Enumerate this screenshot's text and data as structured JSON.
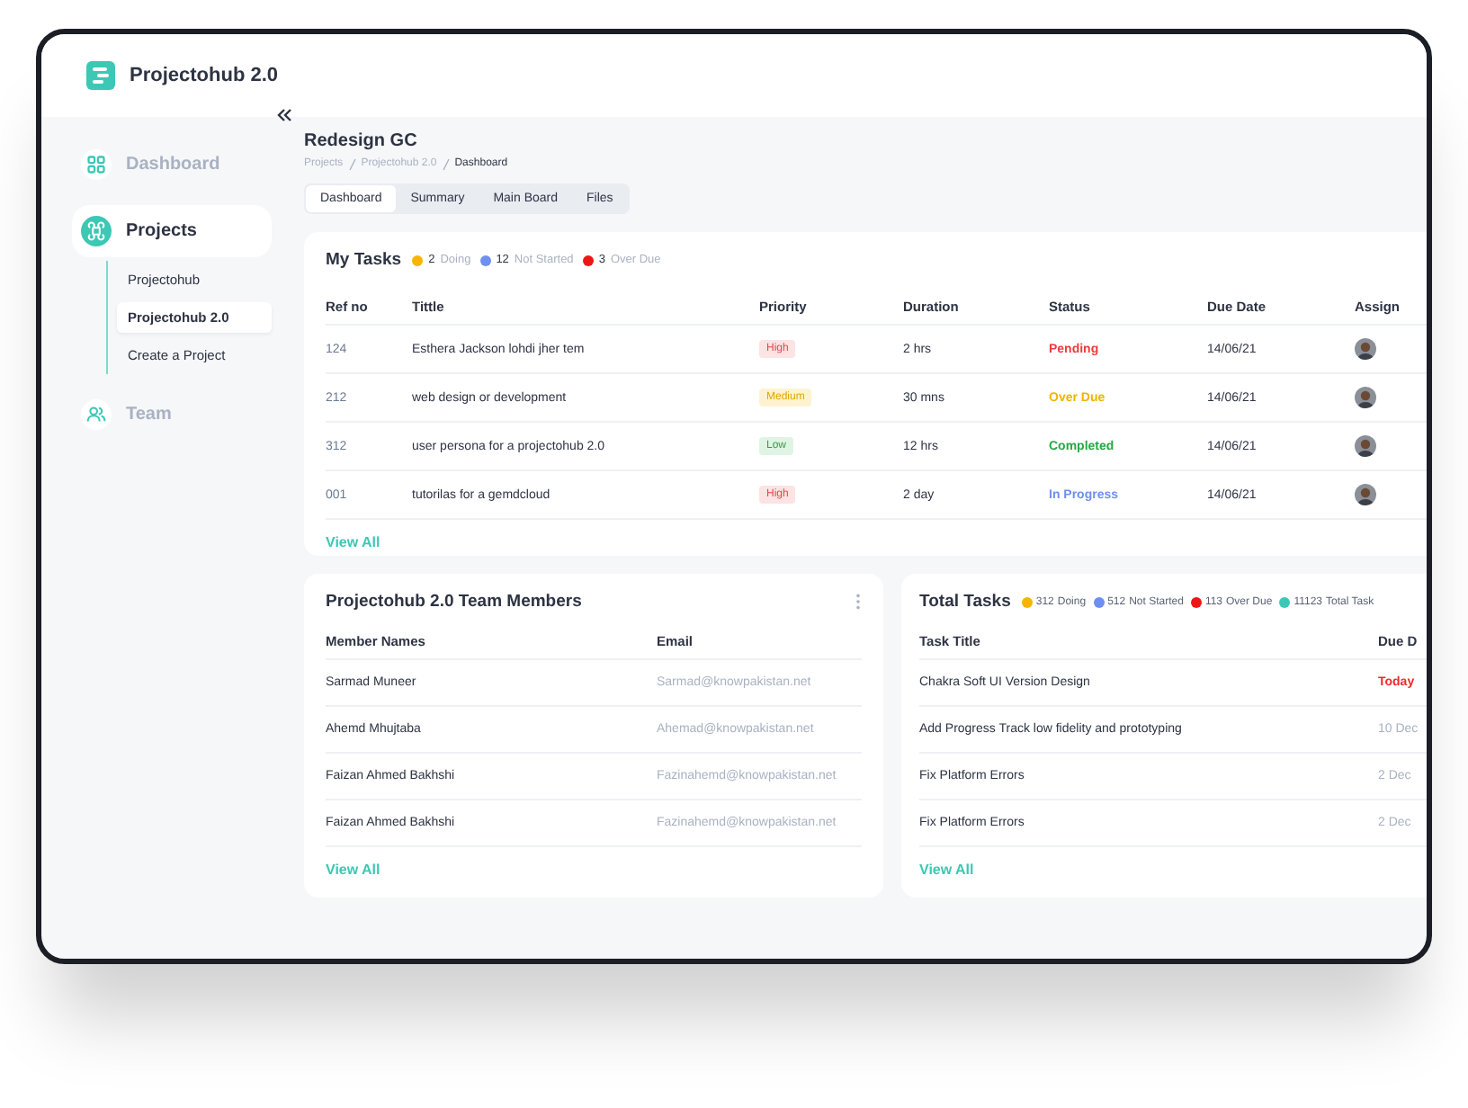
{
  "app": {
    "name": "Projectohub 2.0"
  },
  "sidebar": {
    "items": [
      {
        "label": "Dashboard",
        "kind": "grid",
        "selected": false
      },
      {
        "label": "Projects",
        "kind": "command",
        "selected": true,
        "children": [
          {
            "label": "Projectohub",
            "selected": false
          },
          {
            "label": "Projectohub 2.0",
            "selected": true
          },
          {
            "label": "Create a Project",
            "selected": false
          }
        ]
      },
      {
        "label": "Team",
        "kind": "people",
        "selected": false
      }
    ]
  },
  "page": {
    "title": "Redesign GC",
    "breadcrumb": [
      "Projects",
      "Projectohub 2.0",
      "Dashboard"
    ],
    "tabs": [
      {
        "label": "Dashboard",
        "selected": true
      },
      {
        "label": "Summary",
        "selected": false
      },
      {
        "label": "Main Board",
        "selected": false
      },
      {
        "label": "Files",
        "selected": false
      }
    ]
  },
  "my_tasks": {
    "title": "My Tasks",
    "legend": [
      {
        "count": "2",
        "label": "Doing",
        "color": "#f7b500"
      },
      {
        "count": "12",
        "label": "Not Started",
        "color": "#6d8ff2"
      },
      {
        "count": "3",
        "label": "Over Due",
        "color": "#f01515"
      }
    ],
    "columns": [
      "Ref no",
      "Tittle",
      "Priority",
      "Duration",
      "Status",
      "Due Date",
      "Assign"
    ],
    "rows": [
      {
        "ref": "124",
        "title": "Esthera Jackson lohdi jher tem",
        "priority": {
          "text": "High",
          "kind": "high"
        },
        "duration": "2 hrs",
        "status": {
          "text": "Pending",
          "kind": "pending"
        },
        "due": "14/06/21"
      },
      {
        "ref": "212",
        "title": "web design or development",
        "priority": {
          "text": "Medium",
          "kind": "medium"
        },
        "duration": "30 mns",
        "status": {
          "text": "Over Due",
          "kind": "overdue"
        },
        "due": "14/06/21"
      },
      {
        "ref": "312",
        "title": "user persona for a projectohub 2.0",
        "priority": {
          "text": "Low",
          "kind": "low"
        },
        "duration": "12 hrs",
        "status": {
          "text": "Completed",
          "kind": "completed"
        },
        "due": "14/06/21"
      },
      {
        "ref": "001",
        "title": "tutorilas for a gemdcloud",
        "priority": {
          "text": "High",
          "kind": "high"
        },
        "duration": "2 day",
        "status": {
          "text": "In Progress",
          "kind": "progress"
        },
        "due": "14/06/21"
      }
    ],
    "view_all": "View All"
  },
  "team_members": {
    "title": "Projectohub 2.0 Team Members",
    "columns": [
      "Member Names",
      "Email"
    ],
    "rows": [
      {
        "name": "Sarmad Muneer",
        "email": "Sarmad@knowpakistan.net"
      },
      {
        "name": "Ahemd Mhujtaba",
        "email": "Ahemad@knowpakistan.net"
      },
      {
        "name": "Faizan Ahmed Bakhshi",
        "email": "Fazinahemd@knowpakistan.net"
      },
      {
        "name": "Faizan Ahmed Bakhshi",
        "email": "Fazinahemd@knowpakistan.net"
      }
    ],
    "view_all": "View All"
  },
  "total_tasks": {
    "title": "Total Tasks",
    "legend": [
      {
        "count": "312",
        "label": "Doing",
        "color": "#f7b500"
      },
      {
        "count": "512",
        "label": "Not Started",
        "color": "#6d8ff2"
      },
      {
        "count": "113",
        "label": "Over Due",
        "color": "#f01515"
      },
      {
        "count": "11123",
        "label": "Total Task",
        "color": "#3cc8b4"
      }
    ],
    "columns": [
      "Task Title",
      "Due D"
    ],
    "rows": [
      {
        "title": "Chakra Soft UI Version Design",
        "due": {
          "text": "Today",
          "kind": "today"
        }
      },
      {
        "title": "Add Progress Track low fidelity and prototyping",
        "due": {
          "text": "10 Dec",
          "kind": "later"
        }
      },
      {
        "title": "Fix Platform Errors",
        "due": {
          "text": "2 Dec",
          "kind": "later"
        }
      },
      {
        "title": "Fix Platform Errors",
        "due": {
          "text": "2 Dec",
          "kind": "later"
        }
      }
    ],
    "view_all": "View All"
  }
}
